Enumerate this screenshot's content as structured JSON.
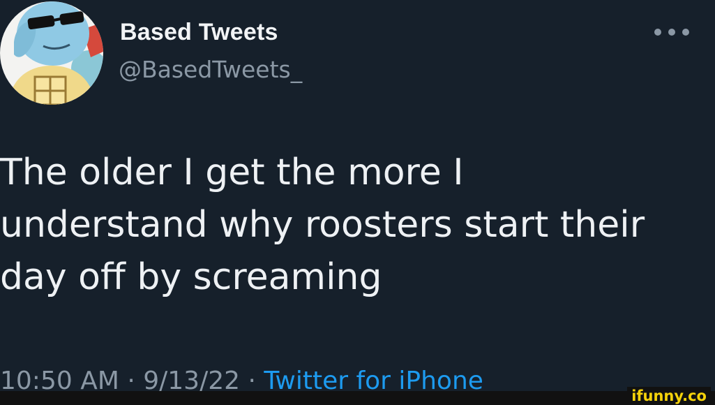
{
  "author": {
    "display_name": "Based Tweets",
    "handle": "@BasedTweets_",
    "avatar_icon": "squirtle-sunglasses-avatar"
  },
  "more_icon": "more-dots-icon",
  "tweet": {
    "lines": [
      "The older I get the more I",
      "understand why roosters start their",
      "day off by screaming"
    ]
  },
  "meta": {
    "time": "10:50 AM",
    "separator": " · ",
    "date": "9/13/22",
    "source": "Twitter for iPhone"
  },
  "watermark": {
    "text": "ifunny.co"
  },
  "colors": {
    "background": "#16202b",
    "text": "#eef1f4",
    "secondary": "#8b98a5",
    "accent": "#1d9bf0",
    "watermark": "#f5d20a"
  }
}
